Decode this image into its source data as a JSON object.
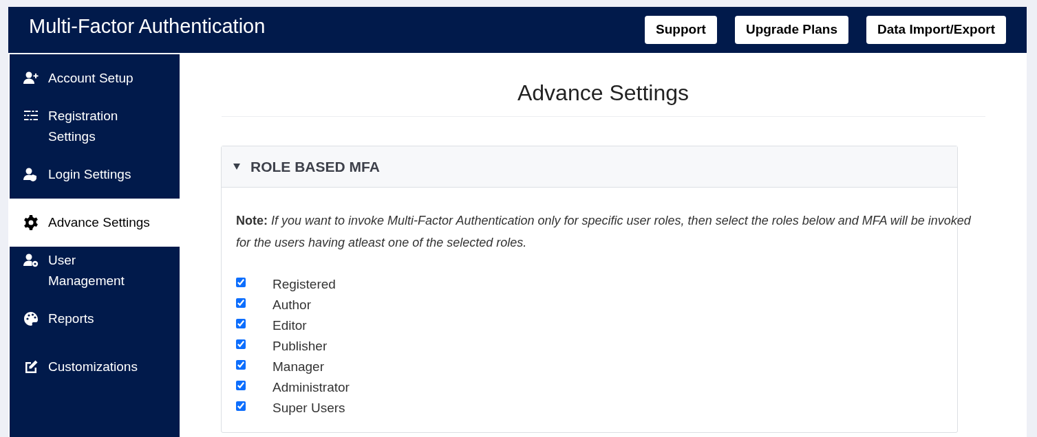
{
  "header": {
    "title": "Multi-Factor Authentication",
    "buttons": [
      "Support",
      "Upgrade Plans",
      "Data Import/Export"
    ]
  },
  "sidebar": {
    "items": [
      {
        "label": "Account Setup",
        "selected": false
      },
      {
        "label": "Registration Settings",
        "selected": false
      },
      {
        "label": "Login Settings",
        "selected": false
      },
      {
        "label": "Advance Settings",
        "selected": true
      },
      {
        "label": "User Management",
        "selected": false
      },
      {
        "label": "Reports",
        "selected": false
      },
      {
        "label": "Customizations",
        "selected": false
      }
    ]
  },
  "page": {
    "heading": "Advance Settings"
  },
  "panel": {
    "title": "ROLE BASED MFA",
    "expanded": true,
    "note": "**Note:** *If you want to invoke Multi-Factor Authentication only for specific user roles, then select the roles below and MFA will be invoked for the users having atleast one of the selected roles.*",
    "roles": [
      {
        "label": "Registered",
        "checked": true
      },
      {
        "label": "Author",
        "checked": true
      },
      {
        "label": "Editor",
        "checked": true
      },
      {
        "label": "Publisher",
        "checked": true
      },
      {
        "label": "Manager",
        "checked": true
      },
      {
        "label": "Administrator",
        "checked": true
      },
      {
        "label": "Super Users",
        "checked": true
      }
    ]
  }
}
